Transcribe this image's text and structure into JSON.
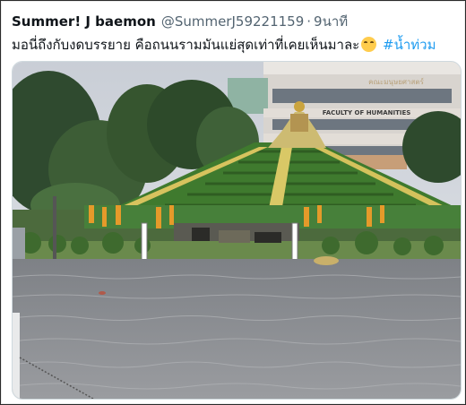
{
  "tweet": {
    "display_name": "Summer! J baemon",
    "handle": "@SummerJ59221159",
    "separator": "·",
    "time": "9นาที",
    "more": "⋮",
    "text": "มอนี่ถึงกับงดบรรยาย คือถนนรามมันแย่สุดเท่าที่เคยเห็นมาละ",
    "emoji": "joy-emoji",
    "hashtag": "#น้ำท่วม"
  },
  "photo": {
    "sign_thai": "คณะมนุษยศาสตร์",
    "sign_en": "FACULTY OF HUMANITIES"
  },
  "colors": {
    "link": "#1d9bf0",
    "text": "#0f1419",
    "muted": "#536471",
    "water": "#8d9094"
  }
}
